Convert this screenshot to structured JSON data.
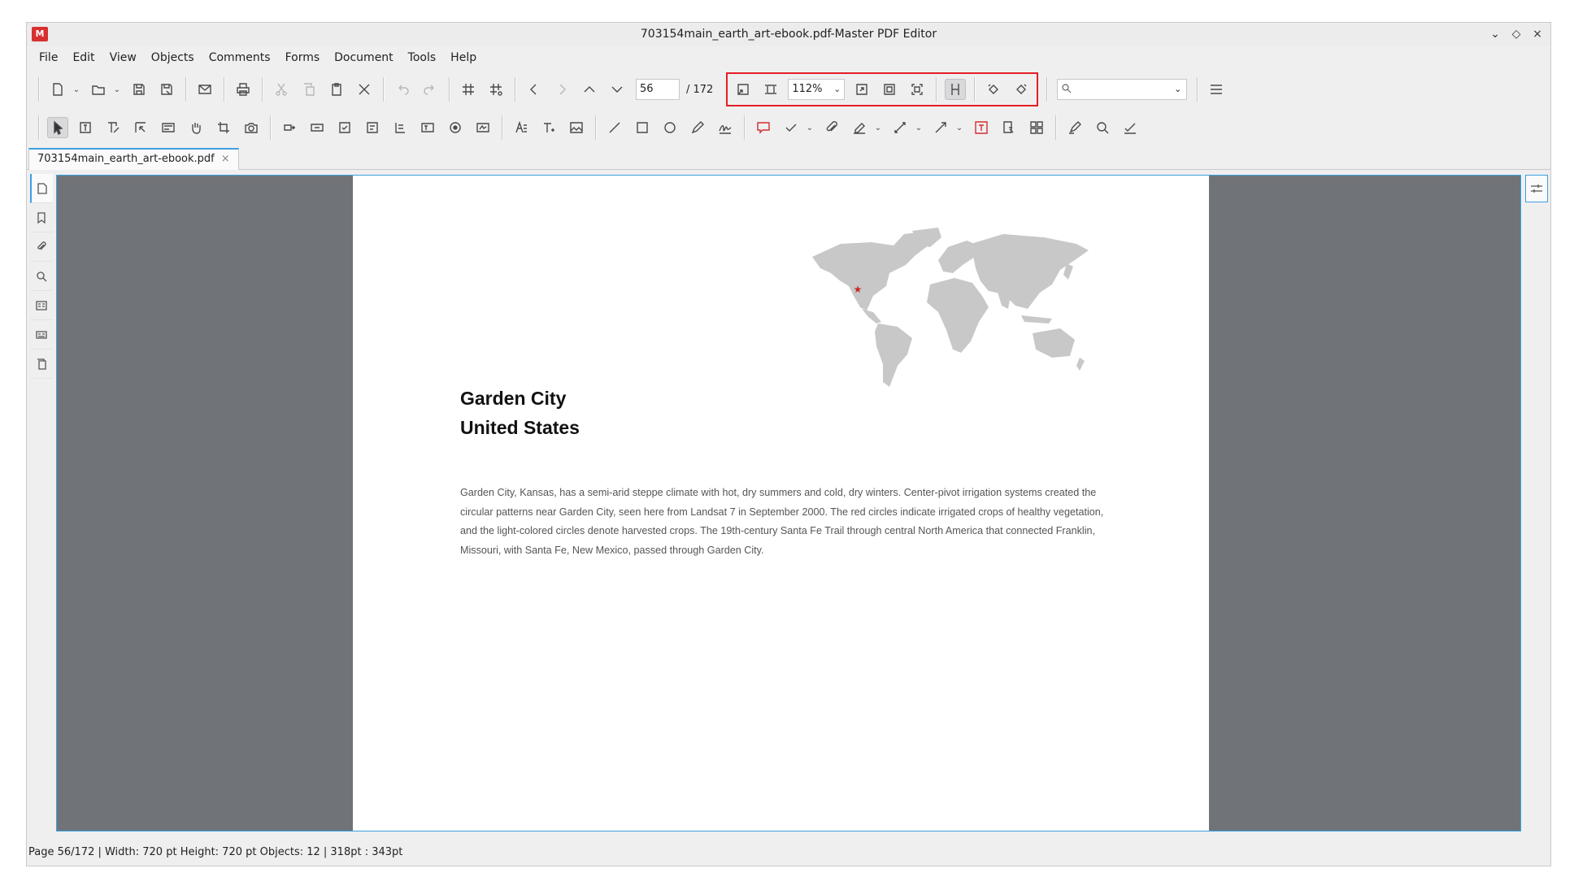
{
  "window": {
    "title": "703154main_earth_art-ebook.pdf-Master PDF Editor",
    "logo_text": "M",
    "controls": {
      "minimize": "⌄",
      "maximize": "◇",
      "close": "×"
    }
  },
  "menu": [
    "File",
    "Edit",
    "View",
    "Objects",
    "Comments",
    "Forms",
    "Document",
    "Tools",
    "Help"
  ],
  "toolbar": {
    "page_number": "56",
    "page_total": "/ 172",
    "zoom": "112%",
    "search_placeholder": ""
  },
  "tab": {
    "label": "703154main_earth_art-ebook.pdf",
    "close": "×"
  },
  "document": {
    "title_line1": "Garden City",
    "title_line2": "United States",
    "body": "Garden City, Kansas, has a semi-arid steppe climate with hot, dry summers and cold, dry winters. Center-pivot irrigation systems created the circular patterns near Garden City, seen here from Landsat 7 in September 2000. The red circles indicate irrigated crops of healthy vegetation, and the light-colored circles denote harvested crops. The 19th-century Santa Fe Trail through central North America that connected Franklin, Missouri, with Santa Fe, New Mexico, passed through Garden City.",
    "map_marker_color": "#c62828",
    "map_color": "#c8c8c8"
  },
  "status": {
    "text": "Page 56/172 | Width: 720 pt Height: 720 pt Objects: 12   |   318pt : 343pt"
  },
  "colors": {
    "highlight": "#e21f26",
    "accent": "#3ca0e0",
    "viewport_bg": "#707377"
  }
}
